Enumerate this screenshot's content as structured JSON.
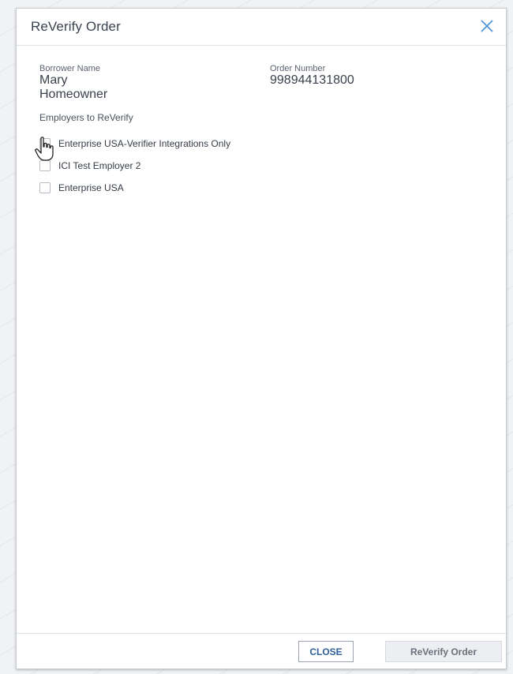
{
  "modal": {
    "title": "ReVerify Order",
    "close_icon": "close-x-icon",
    "accent_color": "#4a90d9"
  },
  "borrower": {
    "label": "Borrower Name",
    "value": "Mary Homeowner"
  },
  "order": {
    "label": "Order Number",
    "value": "998944131800"
  },
  "employers": {
    "section_label": "Employers to ReVerify",
    "items": [
      {
        "label": "Enterprise USA-Verifier Integrations Only",
        "checked": false
      },
      {
        "label": "ICI Test Employer 2",
        "checked": false
      },
      {
        "label": "Enterprise USA",
        "checked": false
      }
    ]
  },
  "footer": {
    "close_label": "CLOSE",
    "reverify_label": "ReVerify Order"
  }
}
